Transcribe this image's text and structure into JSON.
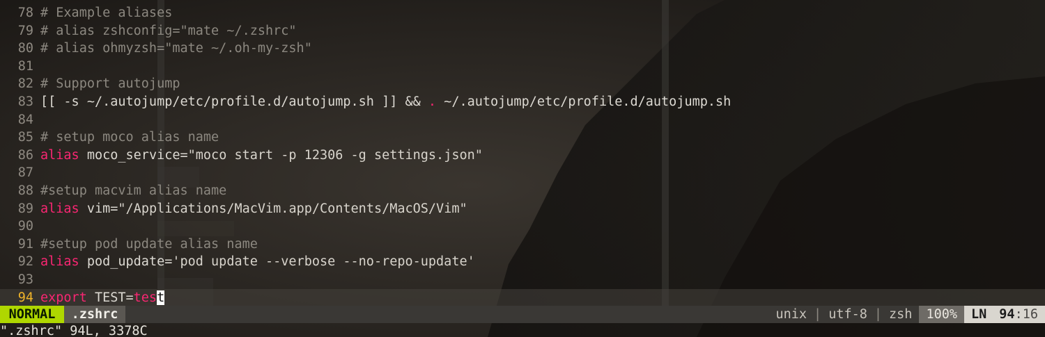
{
  "editor": {
    "lines": [
      {
        "num": "78",
        "tokens": [
          {
            "cls": "tok-comment",
            "text": "# Example aliases"
          }
        ]
      },
      {
        "num": "79",
        "tokens": [
          {
            "cls": "tok-comment",
            "text": "# alias zshconfig=\"mate ~/.zshrc\""
          }
        ]
      },
      {
        "num": "80",
        "tokens": [
          {
            "cls": "tok-comment",
            "text": "# alias ohmyzsh=\"mate ~/.oh-my-zsh\""
          }
        ]
      },
      {
        "num": "81",
        "tokens": []
      },
      {
        "num": "82",
        "tokens": [
          {
            "cls": "tok-comment",
            "text": "# Support autojump"
          }
        ]
      },
      {
        "num": "83",
        "tokens": [
          {
            "cls": "tok-text",
            "text": "[[ -s ~/.autojump/etc/profile.d/autojump.sh ]] && "
          },
          {
            "cls": "tok-dot",
            "text": "."
          },
          {
            "cls": "tok-text",
            "text": " ~/.autojump/etc/profile.d/autojump.sh"
          }
        ]
      },
      {
        "num": "84",
        "tokens": []
      },
      {
        "num": "85",
        "tokens": [
          {
            "cls": "tok-comment",
            "text": "# setup moco alias name"
          }
        ]
      },
      {
        "num": "86",
        "tokens": [
          {
            "cls": "tok-keyword",
            "text": "alias"
          },
          {
            "cls": "tok-text",
            "text": " moco_service="
          },
          {
            "cls": "tok-string",
            "text": "\"moco start -p 12306 -g settings.json\""
          }
        ]
      },
      {
        "num": "87",
        "tokens": []
      },
      {
        "num": "88",
        "tokens": [
          {
            "cls": "tok-comment",
            "text": "#setup macvim alias name"
          }
        ]
      },
      {
        "num": "89",
        "tokens": [
          {
            "cls": "tok-keyword",
            "text": "alias"
          },
          {
            "cls": "tok-text",
            "text": " vim="
          },
          {
            "cls": "tok-string",
            "text": "\"/Applications/MacVim.app/Contents/MacOS/Vim\""
          }
        ]
      },
      {
        "num": "90",
        "tokens": []
      },
      {
        "num": "91",
        "tokens": [
          {
            "cls": "tok-comment",
            "text": "#setup pod update alias name"
          }
        ]
      },
      {
        "num": "92",
        "tokens": [
          {
            "cls": "tok-keyword",
            "text": "alias"
          },
          {
            "cls": "tok-text",
            "text": " pod_update="
          },
          {
            "cls": "tok-string",
            "text": "'pod update --verbose --no-repo-update'"
          }
        ]
      },
      {
        "num": "93",
        "tokens": []
      },
      {
        "num": "94",
        "current": true,
        "tokens": [
          {
            "cls": "tok-keyword",
            "text": "export"
          },
          {
            "cls": "tok-text",
            "text": " TEST="
          },
          {
            "cls": "tok-keyword",
            "text": "tes"
          },
          {
            "cls": "cursor",
            "text": "t"
          }
        ]
      }
    ]
  },
  "statusline": {
    "mode": "NORMAL",
    "filename": ".zshrc",
    "fileformat": "unix",
    "separator": "|",
    "encoding": "utf-8",
    "filetype": "zsh",
    "percent": "100%",
    "ln_label": "LN",
    "line": "94",
    "col_sep": ":",
    "col": "16"
  },
  "cmdline": {
    "text": "\".zshrc\" 94L, 3378C"
  },
  "colors": {
    "mode_bg": "#afd700",
    "keyword": "#f92672",
    "cursorline_number": "#f0b429"
  }
}
